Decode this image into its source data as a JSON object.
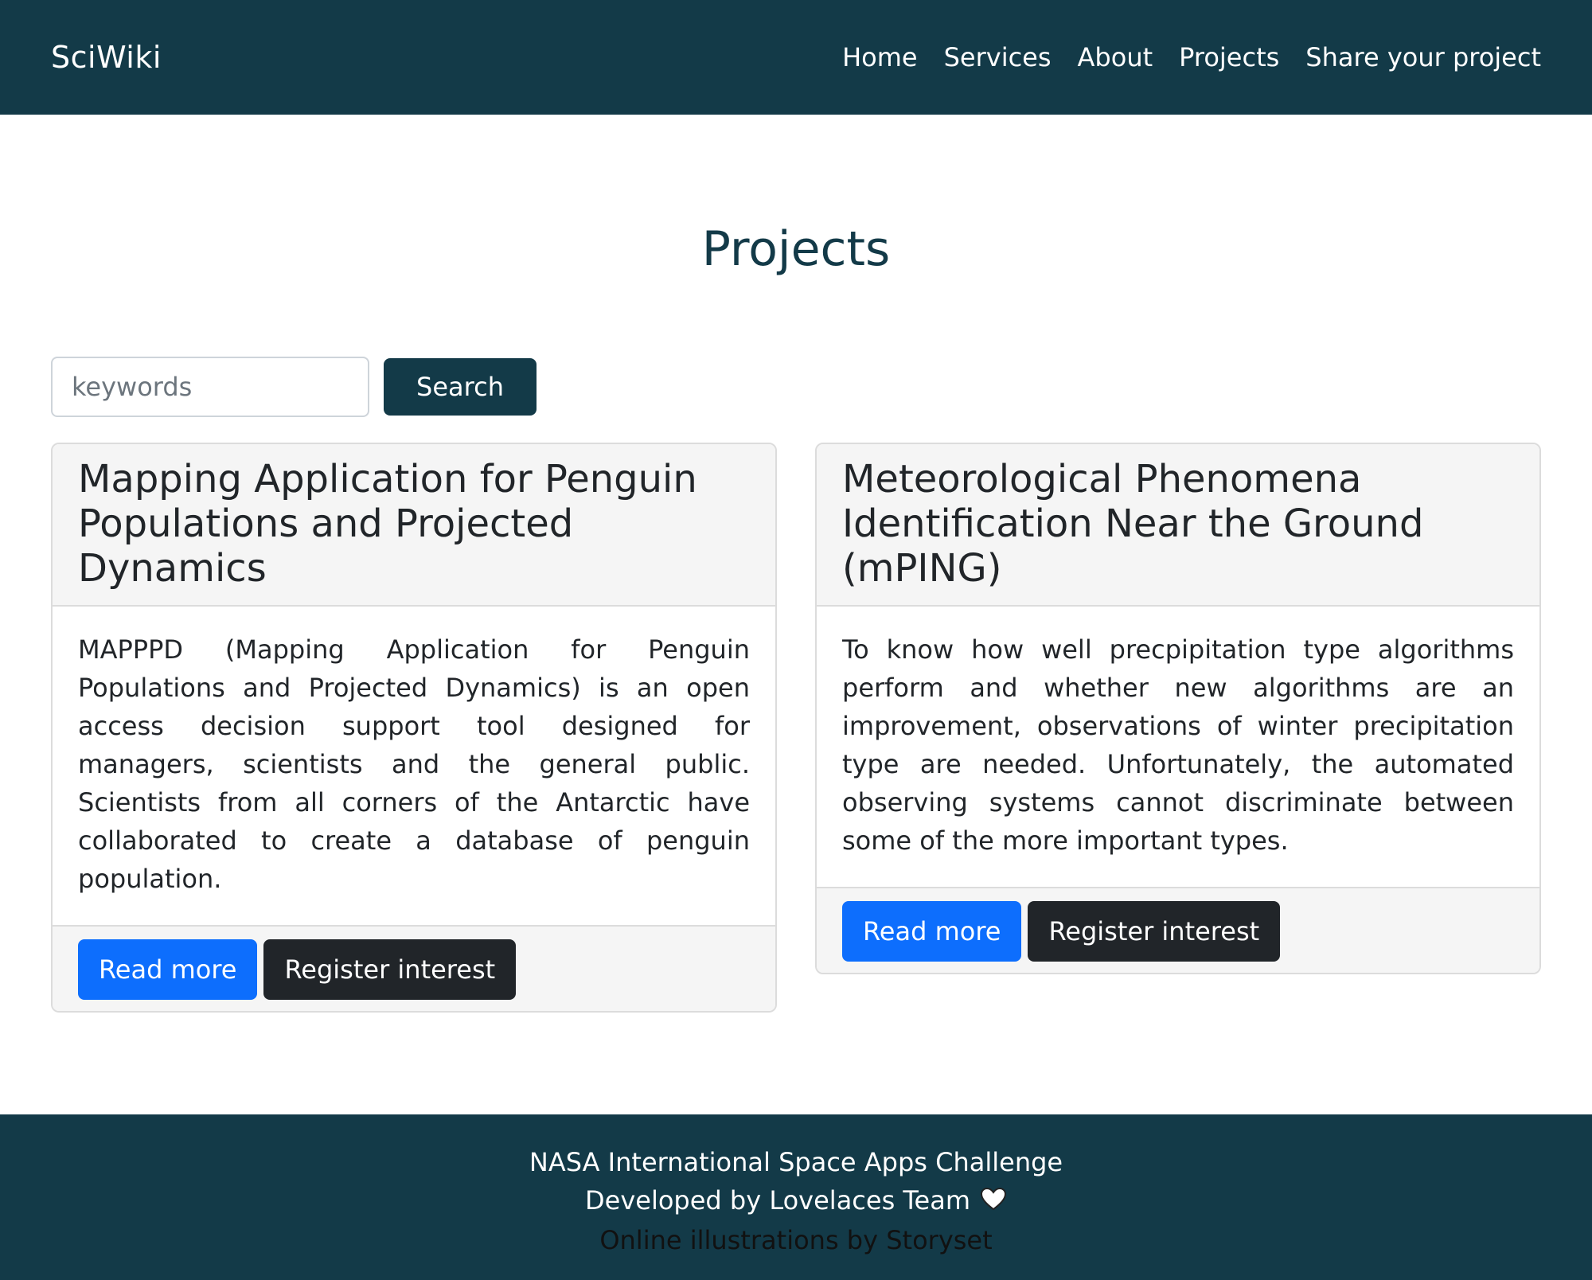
{
  "navbar": {
    "brand": "SciWiki",
    "links": [
      "Home",
      "Services",
      "About",
      "Projects",
      "Share your project"
    ]
  },
  "page": {
    "title": "Projects"
  },
  "search": {
    "placeholder": "keywords",
    "button_label": "Search"
  },
  "projects": [
    {
      "title": "Mapping Application for Penguin Populations and Projected Dynamics",
      "description": "MAPPPD (Mapping Application for Penguin Populations and Projected Dynamics) is an open access decision support tool designed for managers, scientists and the general public. Scientists from all corners of the Antarctic have collaborated to create a database of penguin population.",
      "read_more_label": "Read more",
      "register_label": "Register interest"
    },
    {
      "title": "Meteorological Phenomena Identification Near the Ground (mPING)",
      "description": "To know how well precpipitation type algorithms perform and whether new algorithms are an improvement, observations of winter precipitation type are needed. Unfortunately, the automated observing systems cannot discriminate between some of the more important types.",
      "read_more_label": "Read more",
      "register_label": "Register interest"
    }
  ],
  "footer": {
    "line1": "NASA International Space Apps Challenge",
    "line2": "Developed by Lovelaces Team",
    "credit": "Online illustrations by Storyset",
    "heart_icon": "heart-icon"
  },
  "colors": {
    "primary_dark": "#133a48",
    "read_more": "#0d6efd",
    "register": "#212529"
  }
}
